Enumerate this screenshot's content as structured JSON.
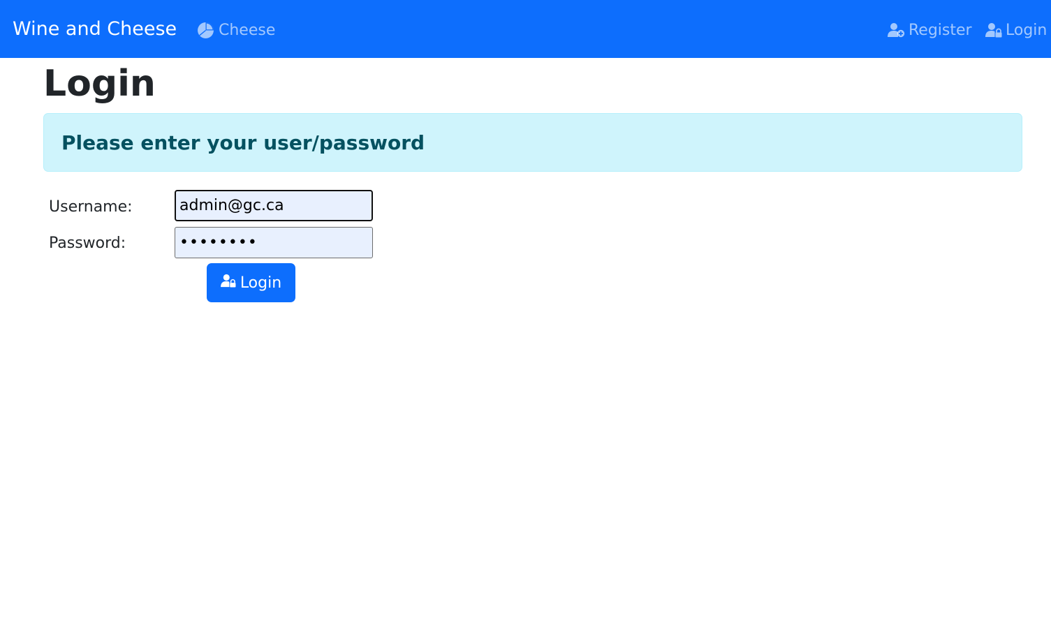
{
  "navbar": {
    "brand": "Wine and Cheese",
    "bg_color": "#0d6efd",
    "left_links": [
      {
        "label": "Cheese",
        "icon": "pie-chart-icon"
      }
    ],
    "right_links": [
      {
        "label": "Register",
        "icon": "user-plus-icon"
      },
      {
        "label": "Login",
        "icon": "user-lock-icon"
      }
    ]
  },
  "page": {
    "title": "Login"
  },
  "alert": {
    "message": "Please enter your user/password",
    "bg_color": "#cff4fc",
    "text_color": "#055160"
  },
  "form": {
    "username_label": "Username:",
    "username_value": "admin@gc.ca",
    "password_label": "Password:",
    "password_value": "********",
    "submit_label": "Login",
    "submit_icon": "user-lock-icon"
  }
}
